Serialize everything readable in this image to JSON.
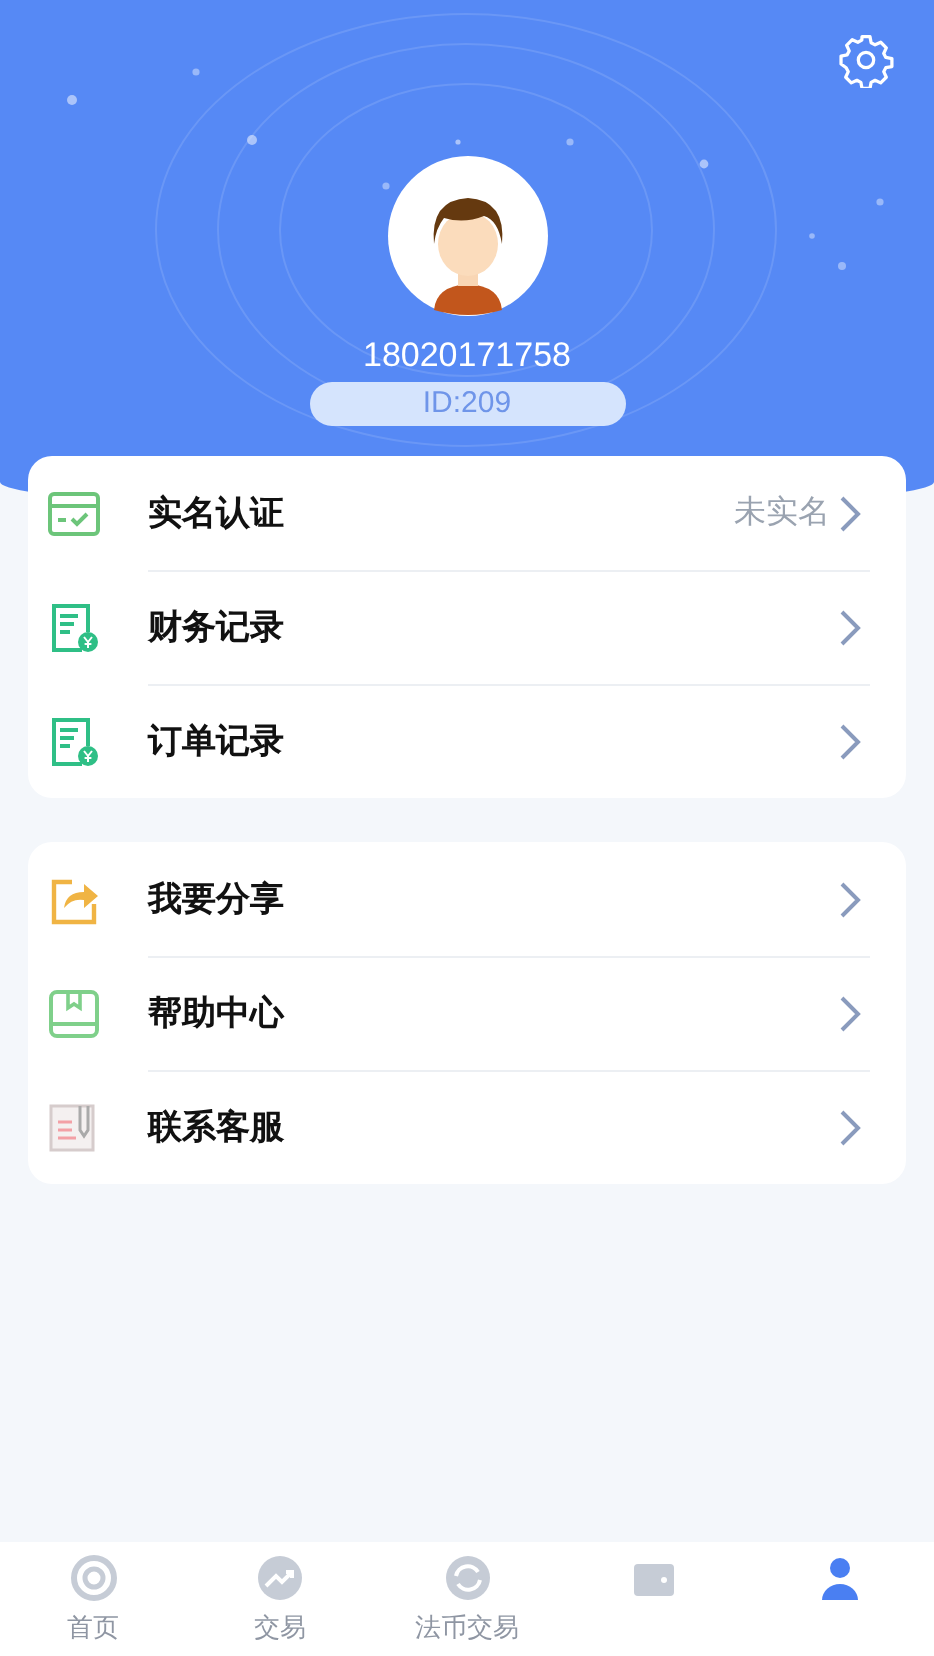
{
  "profile": {
    "phone": "18020171758",
    "id": "ID:209"
  },
  "groups": [
    {
      "items": [
        {
          "kind": "card",
          "label": "实名认证",
          "value": "未实名"
        },
        {
          "kind": "bill",
          "label": "财务记录"
        },
        {
          "kind": "bill",
          "label": "订单记录"
        }
      ]
    },
    {
      "items": [
        {
          "kind": "share",
          "label": "我要分享"
        },
        {
          "kind": "book",
          "label": "帮助中心"
        },
        {
          "kind": "note",
          "label": "联系客服"
        }
      ]
    }
  ],
  "tabs": [
    {
      "kind": "home",
      "label": "首页",
      "selected": false
    },
    {
      "kind": "trend",
      "label": "交易",
      "selected": false
    },
    {
      "kind": "exchange",
      "label": "法币交易",
      "selected": false
    },
    {
      "kind": "wallet",
      "selected": false
    },
    {
      "kind": "user",
      "selected": true
    }
  ]
}
